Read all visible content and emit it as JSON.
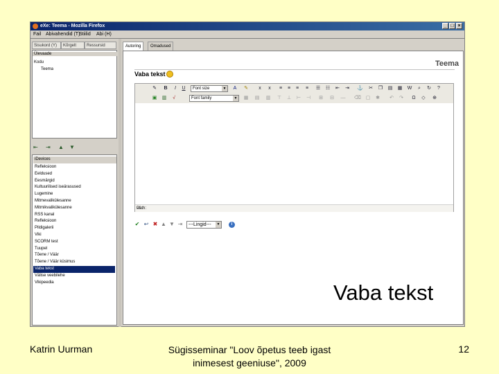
{
  "window": {
    "title": "eXe: Teema - Mozilla Firefox",
    "buttons": [
      "_",
      "□",
      "×"
    ]
  },
  "menu": [
    "Fail",
    "Abivahendid (T)",
    "Stiilid",
    "Abi (H)"
  ],
  "left_tabs": [
    "Sisukord (Y)",
    "Kõrgelt",
    "Ressursid"
  ],
  "outline": {
    "header": "Ülevaade",
    "items": [
      "Kodu",
      "Teema"
    ]
  },
  "idevices": {
    "header": "iDevices",
    "items": [
      "Refleksioon",
      "Eeldused",
      "Eesmärgid",
      "Kultuurilised iseärasused",
      "Lugemine",
      "Mitmevalikülesanne",
      "Mitmikvalikülesanne",
      "RSS kanal",
      "Refleksioon",
      "Pildigalerii",
      "Viki",
      "SCORM test",
      "Tuupel",
      "Tõene / Väär",
      "Tõene / Väär küsimus",
      "Vaba tekst",
      "Välise veebilehe",
      "Vikipeedia"
    ],
    "selected_index": 15
  },
  "right_tabs": [
    "Autoring",
    "Omadused"
  ],
  "content": {
    "breadcrumb": "Teema",
    "section_title": "Vaba tekst",
    "font_size_label": "Font size",
    "font_family_label": "Font family",
    "path_label": "Path:",
    "link_select": "---Lingid---"
  },
  "caption": "Vaba tekst",
  "footer": {
    "author": "Katrin Uurman",
    "event": "Sügisseminar \"Loov õpetus teeb igast inimesest geeniuse\", 2009",
    "page": "12"
  },
  "colors": {
    "slide_background": "#ffffc6",
    "selection": "#0a246a",
    "titlebar": "#0a246a"
  }
}
